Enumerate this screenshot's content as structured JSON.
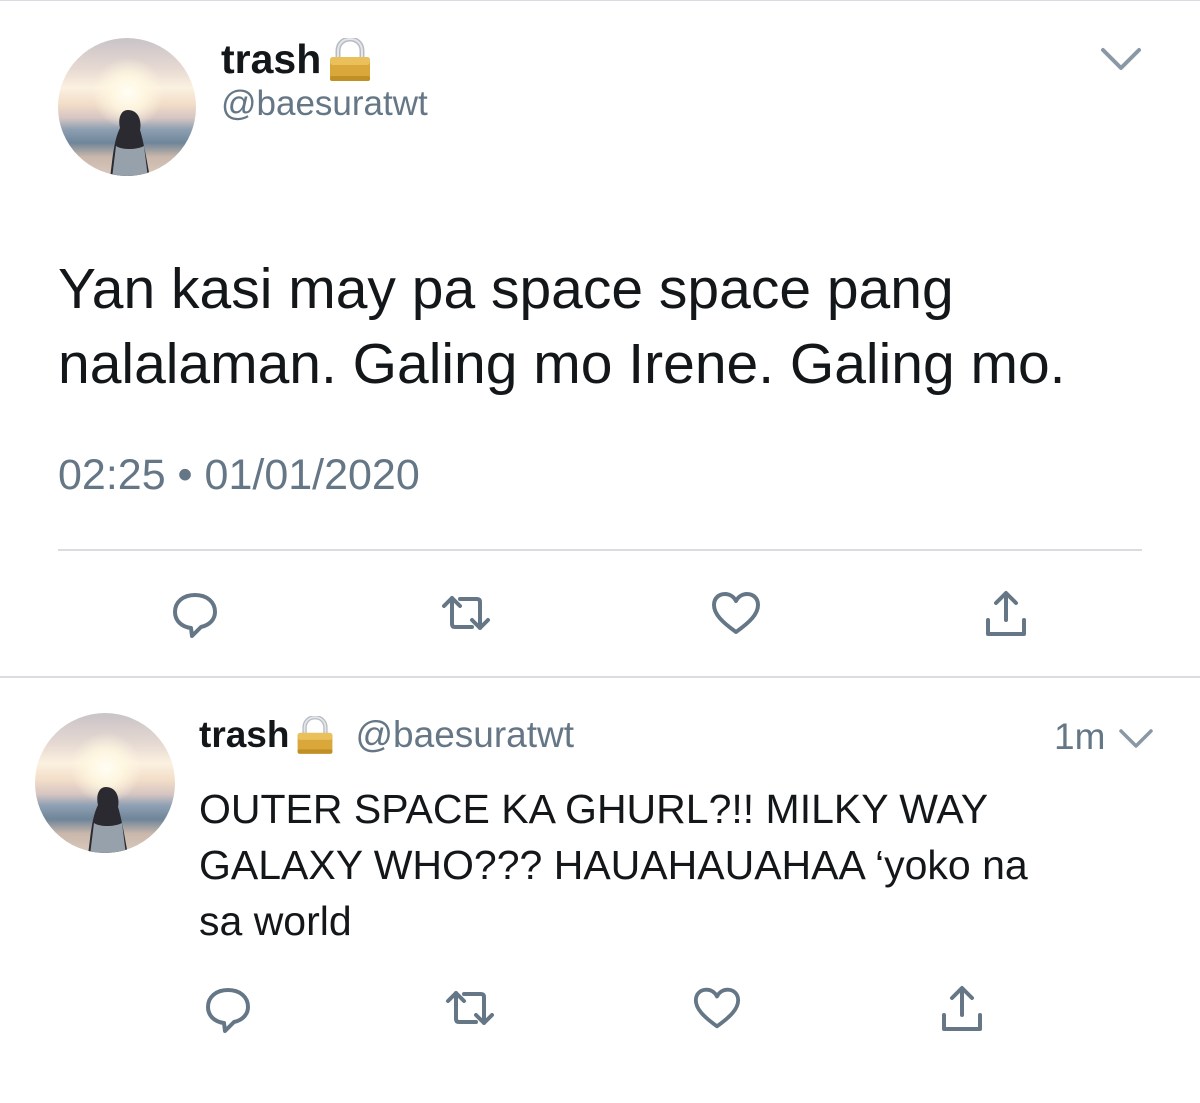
{
  "main_tweet": {
    "display_name": "trash",
    "lock_icon": "lock-icon",
    "handle": "@baesuratwt",
    "text": "Yan kasi may pa space space pang\nnalalaman. Galing mo Irene. Galing mo.",
    "timestamp": "02:25 • 01/01/2020",
    "menu_icon": "chevron-down-icon",
    "actions": [
      "reply-icon",
      "retweet-icon",
      "like-icon",
      "share-icon"
    ]
  },
  "reply_tweet": {
    "display_name": "trash",
    "lock_icon": "lock-icon",
    "handle": "@baesuratwt",
    "time_ago": "1m",
    "text": "OUTER SPACE KA GHURL?!! MILKY WAY\nGALAXY WHO??? HAUAHAUAHAA ‘yoko na\nsa world",
    "menu_icon": "chevron-down-icon",
    "actions": [
      "reply-icon",
      "retweet-icon",
      "like-icon",
      "share-icon"
    ]
  },
  "colors": {
    "text_primary": "#14171a",
    "text_secondary": "#657786",
    "divider": "#d9dde2",
    "icon": "#657786"
  }
}
